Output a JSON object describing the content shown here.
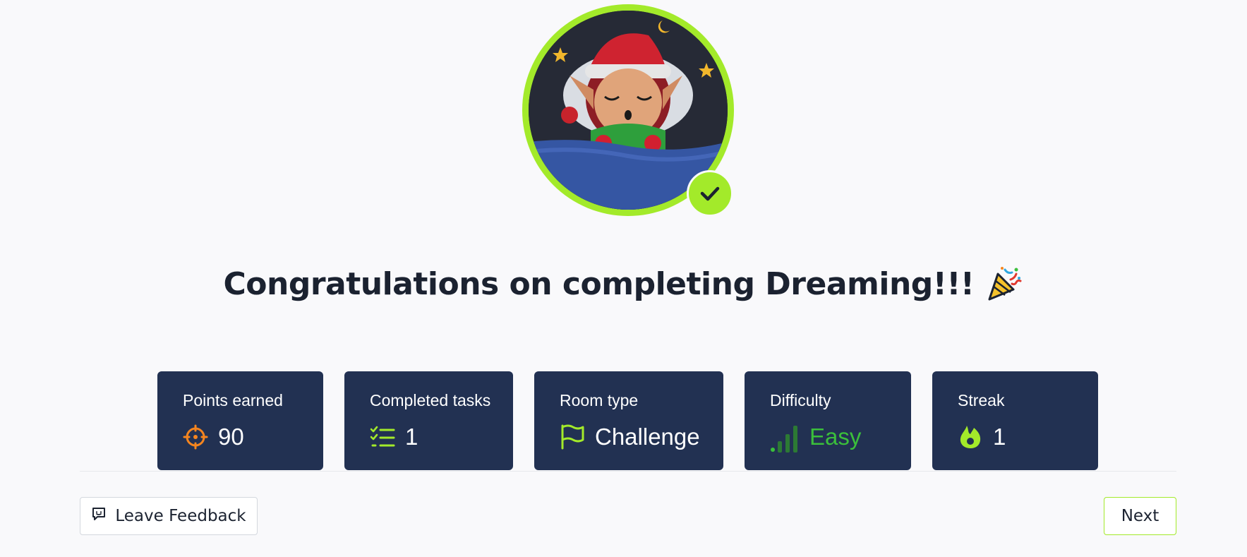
{
  "title": "Congratulations on completing Dreaming!!!",
  "title_emoji": "party-popper-icon",
  "avatar": {
    "alt": "sleeping-elf-avatar",
    "completed": true
  },
  "stats": [
    {
      "label": "Points earned",
      "value": "90",
      "icon": "target-icon"
    },
    {
      "label": "Completed tasks",
      "value": "1",
      "icon": "checklist-icon"
    },
    {
      "label": "Room type",
      "value": "Challenge",
      "icon": "flag-icon"
    },
    {
      "label": "Difficulty",
      "value": "Easy",
      "icon": "signal-bars-icon"
    },
    {
      "label": "Streak",
      "value": "1",
      "icon": "flame-icon"
    }
  ],
  "footer": {
    "feedback_label": "Leave Feedback",
    "next_label": "Next"
  },
  "colors": {
    "accent": "#a3ea2a",
    "card_bg": "#223152",
    "points_icon": "#f5851f",
    "easy": "#3bbf3b",
    "background": "#f9f9fb"
  }
}
